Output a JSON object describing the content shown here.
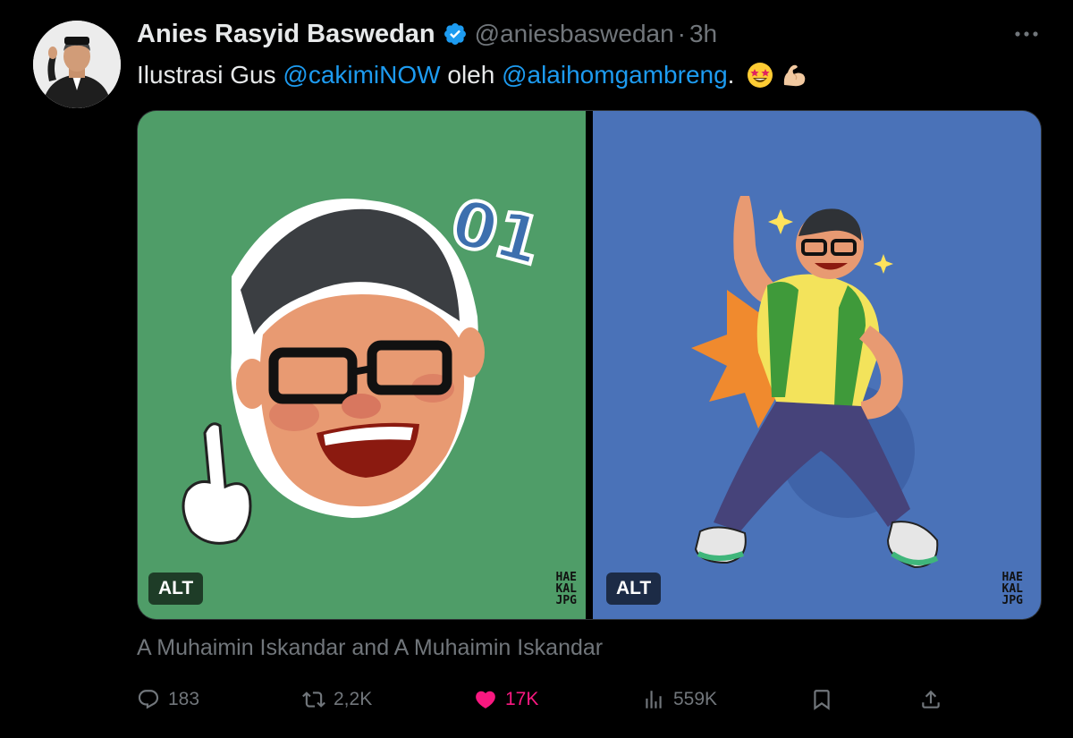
{
  "tweet": {
    "author_name": "Anies Rasyid Baswedan",
    "handle": "@aniesbaswedan",
    "separator": "·",
    "time": "3h",
    "text_parts": {
      "before": "Ilustrasi Gus ",
      "mention1": "@cakimiNOW",
      "middle": " oleh ",
      "mention2": "@alaihomgambreng",
      "after": "."
    },
    "emojis": [
      "star-struck-emoji",
      "flexed-biceps-emoji"
    ],
    "media": [
      {
        "alt_label": "ALT",
        "signature": [
          "HAE",
          "KAL",
          "JPG"
        ],
        "icon": "illustration-face-01"
      },
      {
        "alt_label": "ALT",
        "signature": [
          "HAE",
          "KAL",
          "JPG"
        ],
        "icon": "illustration-dancing-man"
      }
    ],
    "sticker_number": "01",
    "media_caption": "A Muhaimin Iskandar and A Muhaimin Iskandar",
    "stats": {
      "replies": "183",
      "reposts": "2,2K",
      "likes": "17K",
      "views": "559K"
    },
    "colors": {
      "accent": "#1d9bf0",
      "like": "#f91880",
      "muted": "#71767b",
      "left_bg": "#4f9d68",
      "right_bg": "#4a72b8"
    }
  }
}
